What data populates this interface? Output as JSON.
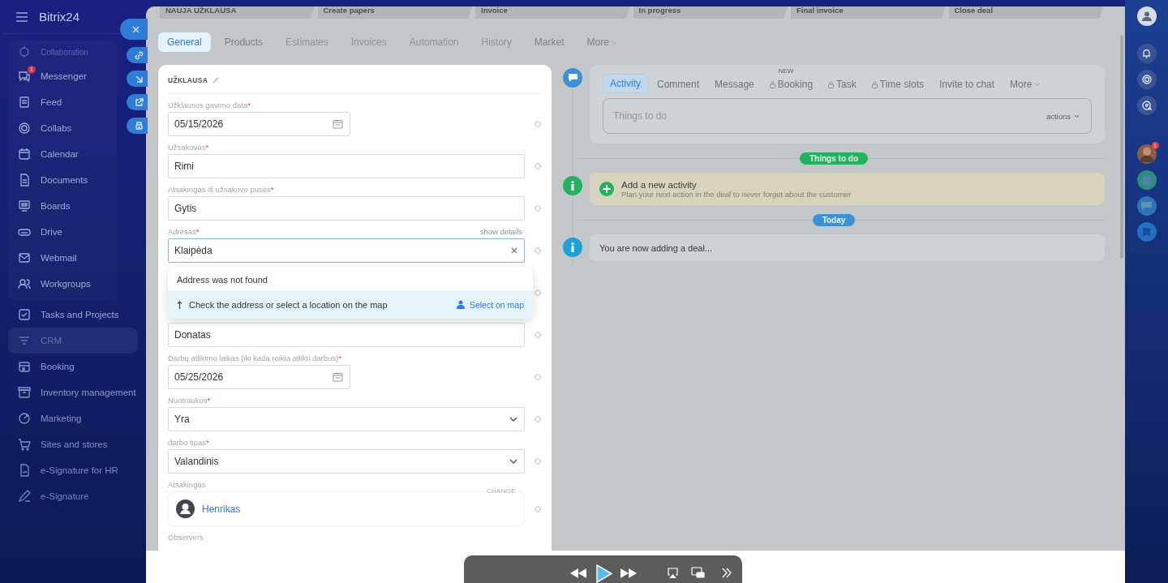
{
  "sidebar": {
    "logo": "Bitrix24",
    "items": [
      {
        "label": "Collaboration",
        "kind": "group",
        "selected": false
      },
      {
        "label": "Messenger",
        "kind": "item",
        "badge": "1",
        "selected": false
      },
      {
        "label": "Feed",
        "kind": "item",
        "selected": false
      },
      {
        "label": "Collabs",
        "kind": "item",
        "selected": false
      },
      {
        "label": "Calendar",
        "kind": "item",
        "selected": false
      },
      {
        "label": "Documents",
        "kind": "item",
        "selected": false
      },
      {
        "label": "Boards",
        "kind": "item",
        "selected": false
      },
      {
        "label": "Drive",
        "kind": "item",
        "selected": false
      },
      {
        "label": "Webmail",
        "kind": "item",
        "selected": false
      },
      {
        "label": "Workgroups",
        "kind": "item",
        "selected": false
      },
      {
        "label": "Tasks and Projects",
        "kind": "item",
        "selected": false
      },
      {
        "label": "CRM",
        "kind": "item",
        "selected": true
      },
      {
        "label": "Booking",
        "kind": "item",
        "selected": false
      },
      {
        "label": "Inventory management",
        "kind": "item",
        "selected": false
      },
      {
        "label": "Marketing",
        "kind": "item",
        "selected": false
      },
      {
        "label": "Sites and stores",
        "kind": "item",
        "selected": false
      },
      {
        "label": "e-Signature for HR",
        "kind": "item",
        "selected": false
      },
      {
        "label": "e-Signature",
        "kind": "item",
        "selected": false
      }
    ]
  },
  "stages": [
    {
      "label": "NAUJA UŽKLAUSA"
    },
    {
      "label": "Create papers"
    },
    {
      "label": "Invoice"
    },
    {
      "label": "In progress"
    },
    {
      "label": "Final invoice"
    },
    {
      "label": "Close deal"
    }
  ],
  "tabs": [
    {
      "label": "General",
      "selected": true,
      "disabled": false
    },
    {
      "label": "Products",
      "selected": false,
      "disabled": false
    },
    {
      "label": "Estimates",
      "selected": false,
      "disabled": true
    },
    {
      "label": "Invoices",
      "selected": false,
      "disabled": true
    },
    {
      "label": "Automation",
      "selected": false,
      "disabled": true
    },
    {
      "label": "History",
      "selected": false,
      "disabled": true
    },
    {
      "label": "Market",
      "selected": false,
      "disabled": false
    },
    {
      "label": "More",
      "selected": false,
      "disabled": false,
      "kind": "menu"
    }
  ],
  "form": {
    "title": "UŽKLAUSA",
    "fields": [
      {
        "label": "Užklausos gavimo data",
        "required_mark": "*",
        "kind": "date",
        "value": "05/15/2026"
      },
      {
        "label": "Užsakovas",
        "required_mark": "*",
        "kind": "text",
        "value": "Rimi"
      },
      {
        "label": "Atsakingas iš užsakovo pusės",
        "required_mark": "*",
        "kind": "text",
        "value": "Gytis"
      },
      {
        "label": "Adresas",
        "required_mark": "*",
        "kind": "address",
        "value": "Klaipėda",
        "details": "show details",
        "focused": true,
        "popup": {
          "message": "Address was not found",
          "hint": "Check the address or select a location on the map",
          "link": "Select on map"
        }
      },
      {
        "kind": "covered"
      },
      {
        "kind": "text",
        "value": "Donatas"
      },
      {
        "label": "Darbų atlikimo laikas (iki kada reikia atlikti darbus)",
        "required_mark": "*",
        "kind": "date",
        "value": "05/25/2026"
      },
      {
        "label": "Nuotraukos",
        "required_mark": "*",
        "kind": "select",
        "value": "Yra"
      },
      {
        "label": "darbo tipas",
        "required_mark": "*",
        "kind": "select",
        "value": "Valandinis"
      },
      {
        "label": "Atsakingas",
        "kind": "user",
        "value": "Henrikas",
        "action": "CHANGE"
      },
      {
        "label": "Observers",
        "kind": "cut"
      }
    ]
  },
  "activity": {
    "tabs": [
      {
        "label": "Activity",
        "selected": true,
        "locked": false
      },
      {
        "label": "Comment",
        "selected": false,
        "locked": false
      },
      {
        "label": "Message",
        "selected": false,
        "locked": false
      },
      {
        "label": "Booking",
        "selected": false,
        "locked": true,
        "tag": "NEW"
      },
      {
        "label": "Task",
        "selected": false,
        "locked": true
      },
      {
        "label": "Time slots",
        "selected": false,
        "locked": true
      },
      {
        "label": "Invite to chat",
        "selected": false,
        "locked": false
      },
      {
        "label": "More",
        "selected": false,
        "locked": false,
        "kind": "menu"
      }
    ],
    "input": {
      "placeholder": "Things to do"
    },
    "actions": "actions"
  },
  "timeline": [
    {
      "kind": "pill",
      "label": "Things to do",
      "color": "#21b35e"
    },
    {
      "kind": "todo",
      "title": "Add a new activity",
      "subtitle": "Plan your next action in the deal to never forget about the customer",
      "color": "#21b35e"
    },
    {
      "kind": "pill",
      "label": "Today",
      "color": "#3d8fd6"
    },
    {
      "kind": "note",
      "title": "You are now adding a deal...",
      "color": "#1aa3d4"
    }
  ],
  "right_bar": {
    "badge": "1"
  }
}
